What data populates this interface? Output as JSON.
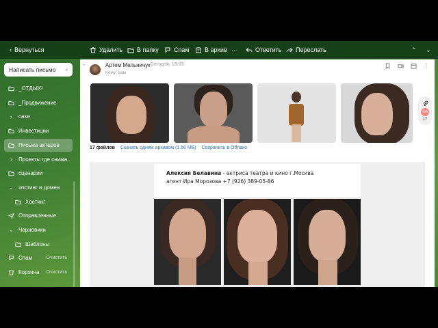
{
  "toolbar": {
    "back": "Вернуться",
    "delete": "Удалить",
    "to_folder": "В папку",
    "spam": "Спам",
    "archive": "В архив",
    "more": "···",
    "reply": "Ответить",
    "forward": "Переслать"
  },
  "sidebar": {
    "compose": "Написать письмо",
    "items": [
      {
        "label": "_ОТДЫХ!",
        "icon": "folder-icon"
      },
      {
        "label": "_Продвижение",
        "icon": "folder-icon"
      },
      {
        "label": "case",
        "icon": "chevron-right-icon"
      },
      {
        "label": "Инвестиции",
        "icon": "folder-icon"
      },
      {
        "label": "Письма актеров",
        "icon": "folder-icon",
        "active": true
      },
      {
        "label": "Проекты где снима...",
        "icon": "chevron-right-icon"
      },
      {
        "label": "сценарии",
        "icon": "folder-icon"
      },
      {
        "label": "хостинг и домен",
        "icon": "chevron-down-icon"
      },
      {
        "label": "Хостинг",
        "icon": "folder-icon"
      },
      {
        "label": "Отправленные",
        "icon": "send-icon"
      },
      {
        "label": "Черновики",
        "icon": "chevron-down-icon"
      },
      {
        "label": "Шаблоны",
        "icon": "folder-icon"
      },
      {
        "label": "Спам",
        "icon": "spam-icon",
        "clear": "Очистить"
      },
      {
        "label": "Корзина",
        "icon": "trash-icon",
        "clear": "Очистить"
      }
    ]
  },
  "message": {
    "sender": "Артем Мельничук",
    "date": "Сегодня, 18:03",
    "to": "Кому: вам",
    "files_count": "17 файлов",
    "download_archive": "Скачать одним архивом (1.66 МБ)",
    "save_cloud": "Сохранить в Облако",
    "attach_count": "17",
    "attach_badge": "N/A"
  },
  "card": {
    "name": "Алексия Белавина",
    "line1_rest": " - актриса театра и кино г.Москва",
    "line2": "агент Ира Морозова +7 (926) 389-05-86"
  }
}
